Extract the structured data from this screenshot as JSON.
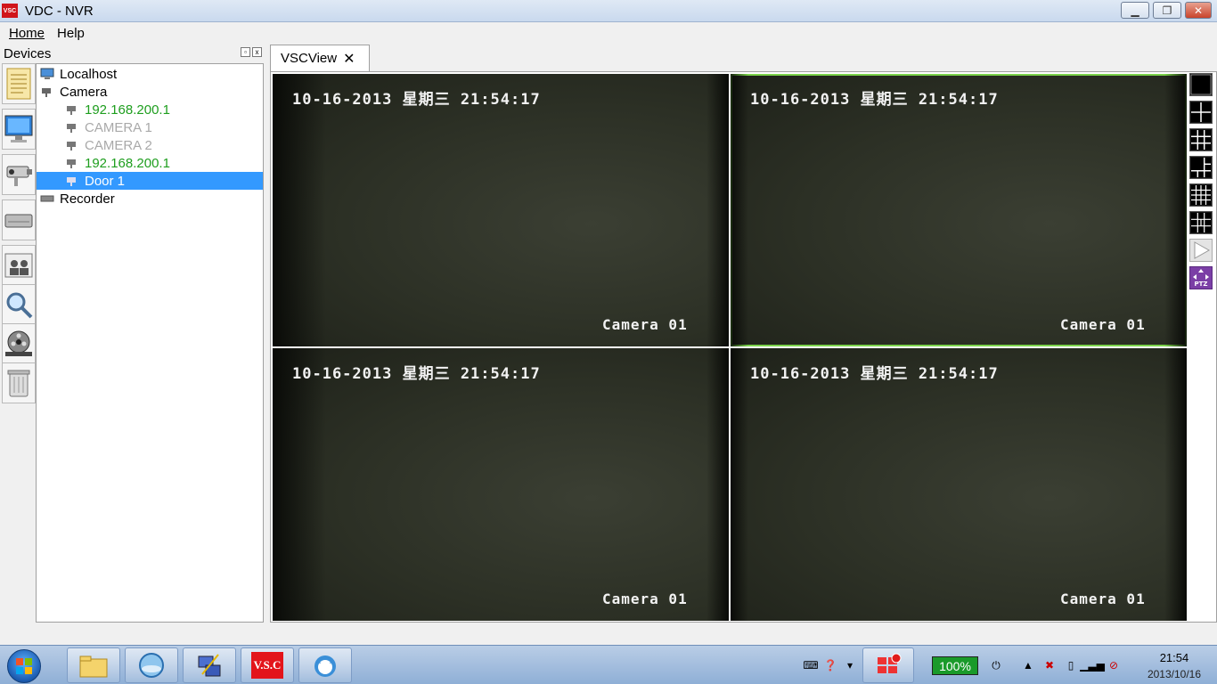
{
  "window": {
    "title": "VDC - NVR",
    "logo_text": "VSC"
  },
  "menu": {
    "home": "Home",
    "help": "Help"
  },
  "devices_panel": {
    "title": "Devices",
    "tree": [
      {
        "label": "Localhost",
        "level": 0,
        "state": "normal"
      },
      {
        "label": "Camera",
        "level": 0,
        "state": "normal"
      },
      {
        "label": "192.168.200.1",
        "level": 1,
        "state": "online"
      },
      {
        "label": "CAMERA 1",
        "level": 1,
        "state": "offline"
      },
      {
        "label": "CAMERA 2",
        "level": 1,
        "state": "offline"
      },
      {
        "label": "192.168.200.1",
        "level": 1,
        "state": "online"
      },
      {
        "label": "Door 1",
        "level": 1,
        "state": "selected"
      },
      {
        "label": "Recorder",
        "level": 0,
        "state": "normal"
      }
    ],
    "tools": [
      "notes-icon",
      "monitor-icon",
      "camera-icon",
      "recorder-icon",
      "people-icon",
      "search-icon",
      "film-icon",
      "trash-icon"
    ]
  },
  "tab": {
    "label": "VSCView",
    "close": "✕"
  },
  "video": {
    "cells": [
      {
        "timestamp": "10-16-2013 星期三 21:54:17",
        "camera": "Camera 01",
        "active": false
      },
      {
        "timestamp": "10-16-2013 星期三 21:54:17",
        "camera": "Camera 01",
        "active": true
      },
      {
        "timestamp": "10-16-2013 星期三 21:54:17",
        "camera": "Camera 01",
        "active": false
      },
      {
        "timestamp": "10-16-2013 星期三 21:54:17",
        "camera": "Camera 01",
        "active": false
      }
    ],
    "layouts": [
      "layout-1-icon",
      "layout-4-icon",
      "layout-9-icon",
      "layout-6-icon",
      "layout-16-icon",
      "layout-custom-icon",
      "play-icon",
      "ptz-icon"
    ],
    "ptz_label": "PTZ",
    "border_color": "#7bd34a"
  },
  "taskbar": {
    "vsc_label": "V.S.C",
    "battery": "100%",
    "time": "21:54",
    "date": "2013/10/16"
  }
}
